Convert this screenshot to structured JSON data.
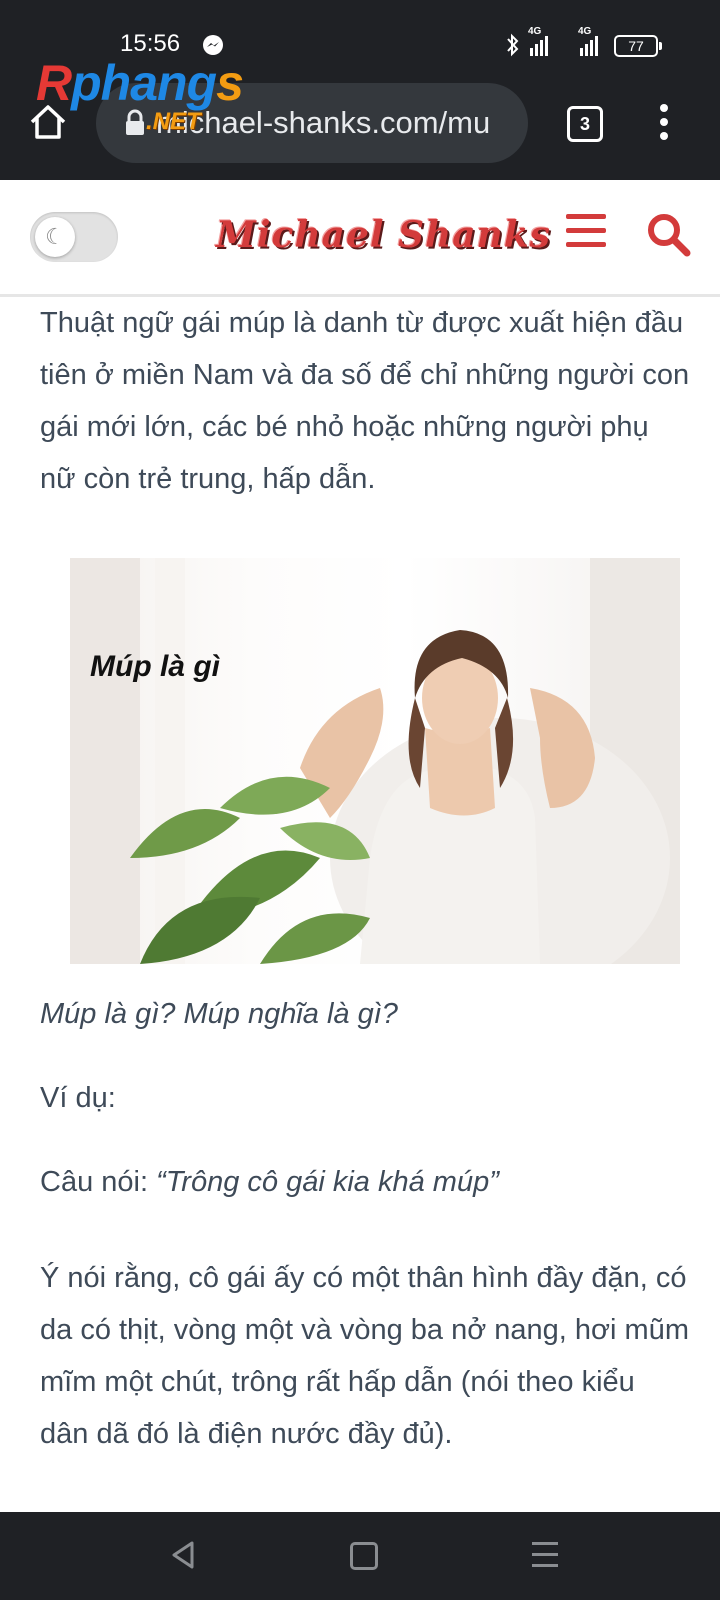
{
  "status_bar": {
    "time": "15:56",
    "signal1_label": "4G",
    "signal2_label": "4G",
    "battery": "77"
  },
  "browser": {
    "url": "michael-shanks.com/mu",
    "tab_count": "3"
  },
  "watermark": {
    "logo_r": "R",
    "logo_p": "phang",
    "logo_s": "s",
    "logo_net": ".NET"
  },
  "site": {
    "logo": "Michael Shanks"
  },
  "article": {
    "para1": "Thuật ngữ gái múp là danh từ được xuất hiện đầu tiên ở miền Nam và đa số để chỉ những người con gái mới lớn, các bé nhỏ hoặc những người phụ nữ còn trẻ trung, hấp dẫn.",
    "image_overlay_text": "Múp là gì",
    "caption": "Múp là gì? Múp nghĩa là gì?",
    "vidu": "Ví dụ:",
    "caunoi_prefix": "Câu nói: ",
    "caunoi_quote": "“Trông cô gái kia khá múp”",
    "para2": "Ý nói rằng, cô gái ấy có một thân hình đầy đặn, có da có thịt, vòng một và vòng ba nở nang, hơi mũm mĩm một chút, trông rất hấp dẫn (nói theo kiểu dân dã đó là điện nước đầy đủ)."
  },
  "colors": {
    "chrome_bg": "#1f2125",
    "brand_red": "#d33b3b",
    "text": "#3e4a58"
  }
}
